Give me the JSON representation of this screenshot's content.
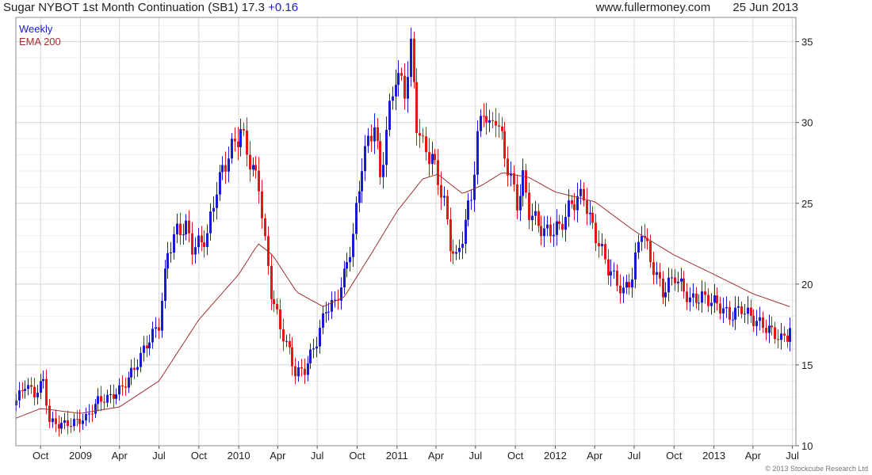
{
  "header": {
    "title": "Sugar NYBOT 1st Month Continuation (SB1)",
    "last": "17.3",
    "change": "+0.16",
    "site": "www.fullermoney.com",
    "date": "25 Jun 2013"
  },
  "legend": {
    "period": "Weekly",
    "indicator": "EMA 200"
  },
  "copyright": "© 2013 Stockcube Research Ltd",
  "colors": {
    "up": "#1a1ad2",
    "down": "#e01818",
    "ema": "#a03030",
    "grid": "#d8d8d8",
    "gridMinor": "#eeeeee"
  },
  "chart_data": {
    "type": "candlestick",
    "interval": "weekly",
    "ylim": [
      10,
      36.5
    ],
    "xlim": [
      "2008-08-05",
      "2013-07-09"
    ],
    "y_ticks": [
      10,
      15,
      20,
      25,
      30,
      35
    ],
    "x_ticks": [
      {
        "date": "2008-10-01",
        "label": "Oct"
      },
      {
        "date": "2009-01-01",
        "label": "2009"
      },
      {
        "date": "2009-04-01",
        "label": "Apr"
      },
      {
        "date": "2009-07-01",
        "label": "Jul"
      },
      {
        "date": "2009-10-01",
        "label": "Oct"
      },
      {
        "date": "2010-01-01",
        "label": "2010"
      },
      {
        "date": "2010-04-01",
        "label": "Apr"
      },
      {
        "date": "2010-07-01",
        "label": "Jul"
      },
      {
        "date": "2010-10-01",
        "label": "Oct"
      },
      {
        "date": "2011-01-01",
        "label": "2011"
      },
      {
        "date": "2011-04-01",
        "label": "Apr"
      },
      {
        "date": "2011-07-01",
        "label": "Jul"
      },
      {
        "date": "2011-10-01",
        "label": "Oct"
      },
      {
        "date": "2012-01-01",
        "label": "2012"
      },
      {
        "date": "2012-04-01",
        "label": "Apr"
      },
      {
        "date": "2012-07-01",
        "label": "Jul"
      },
      {
        "date": "2012-10-01",
        "label": "Oct"
      },
      {
        "date": "2013-01-01",
        "label": "2013"
      },
      {
        "date": "2013-04-01",
        "label": "Apr"
      },
      {
        "date": "2013-07-01",
        "label": "Jul"
      }
    ],
    "grid": true,
    "legend_position": "top-left",
    "close_anchors": [
      [
        "2008-08-05",
        12.8
      ],
      [
        "2008-08-26",
        13.8
      ],
      [
        "2008-09-16",
        13.2
      ],
      [
        "2008-10-07",
        14.0
      ],
      [
        "2008-10-21",
        11.5
      ],
      [
        "2008-11-11",
        11.3
      ],
      [
        "2008-12-09",
        11.4
      ],
      [
        "2009-01-13",
        11.7
      ],
      [
        "2009-02-10",
        12.8
      ],
      [
        "2009-03-10",
        13.0
      ],
      [
        "2009-04-07",
        13.6
      ],
      [
        "2009-05-05",
        14.8
      ],
      [
        "2009-06-02",
        16.3
      ],
      [
        "2009-06-30",
        17.5
      ],
      [
        "2009-07-21",
        22.0
      ],
      [
        "2009-08-11",
        23.3
      ],
      [
        "2009-09-01",
        23.5
      ],
      [
        "2009-09-15",
        22.3
      ],
      [
        "2009-10-06",
        22.6
      ],
      [
        "2009-10-20",
        23.0
      ],
      [
        "2009-11-10",
        26.0
      ],
      [
        "2009-12-08",
        28.0
      ],
      [
        "2010-01-05",
        29.5
      ],
      [
        "2010-02-02",
        27.0
      ],
      [
        "2010-02-16",
        26.2
      ],
      [
        "2010-03-02",
        22.5
      ],
      [
        "2010-03-16",
        19.5
      ],
      [
        "2010-04-06",
        17.3
      ],
      [
        "2010-04-27",
        15.8
      ],
      [
        "2010-05-11",
        14.5
      ],
      [
        "2010-06-01",
        14.7
      ],
      [
        "2010-06-29",
        16.5
      ],
      [
        "2010-07-20",
        18.5
      ],
      [
        "2010-08-10",
        18.8
      ],
      [
        "2010-08-31",
        20.5
      ],
      [
        "2010-09-21",
        23.0
      ],
      [
        "2010-10-12",
        27.5
      ],
      [
        "2010-11-09",
        30.0
      ],
      [
        "2010-11-23",
        26.5
      ],
      [
        "2010-12-07",
        29.5
      ],
      [
        "2010-12-28",
        33.0
      ],
      [
        "2011-01-18",
        32.0
      ],
      [
        "2011-02-01",
        34.5
      ],
      [
        "2011-02-15",
        30.0
      ],
      [
        "2011-03-01",
        28.5
      ],
      [
        "2011-03-22",
        27.8
      ],
      [
        "2011-04-05",
        26.5
      ],
      [
        "2011-04-19",
        25.0
      ],
      [
        "2011-05-03",
        22.5
      ],
      [
        "2011-05-17",
        21.5
      ],
      [
        "2011-05-31",
        23.0
      ],
      [
        "2011-06-21",
        25.5
      ],
      [
        "2011-07-05",
        29.0
      ],
      [
        "2011-07-19",
        31.0
      ],
      [
        "2011-08-02",
        29.5
      ],
      [
        "2011-08-16",
        30.5
      ],
      [
        "2011-09-06",
        28.0
      ],
      [
        "2011-09-20",
        26.5
      ],
      [
        "2011-10-04",
        25.0
      ],
      [
        "2011-10-18",
        26.5
      ],
      [
        "2011-11-01",
        24.5
      ],
      [
        "2011-12-06",
        23.2
      ],
      [
        "2012-01-10",
        23.5
      ],
      [
        "2012-02-07",
        25.0
      ],
      [
        "2012-03-06",
        25.5
      ],
      [
        "2012-03-20",
        24.0
      ],
      [
        "2012-04-10",
        22.5
      ],
      [
        "2012-05-01",
        21.0
      ],
      [
        "2012-06-05",
        19.5
      ],
      [
        "2012-06-26",
        20.5
      ],
      [
        "2012-07-17",
        23.5
      ],
      [
        "2012-08-07",
        21.5
      ],
      [
        "2012-09-04",
        19.5
      ],
      [
        "2012-10-02",
        20.5
      ],
      [
        "2012-11-06",
        19.0
      ],
      [
        "2012-12-04",
        19.2
      ],
      [
        "2013-01-08",
        18.8
      ],
      [
        "2013-02-05",
        18.0
      ],
      [
        "2013-03-05",
        18.5
      ],
      [
        "2013-04-02",
        17.8
      ],
      [
        "2013-05-07",
        17.2
      ],
      [
        "2013-06-04",
        16.6
      ],
      [
        "2013-06-18",
        16.8
      ],
      [
        "2013-06-25",
        17.3
      ]
    ],
    "ema200": [
      [
        "2008-08-05",
        11.7
      ],
      [
        "2008-10-01",
        12.3
      ],
      [
        "2009-01-01",
        12.0
      ],
      [
        "2009-04-01",
        12.4
      ],
      [
        "2009-07-01",
        14.0
      ],
      [
        "2009-10-01",
        17.8
      ],
      [
        "2010-01-01",
        20.6
      ],
      [
        "2010-02-15",
        22.5
      ],
      [
        "2010-03-20",
        21.8
      ],
      [
        "2010-05-15",
        19.5
      ],
      [
        "2010-07-15",
        18.6
      ],
      [
        "2010-09-01",
        19.2
      ],
      [
        "2010-11-01",
        21.8
      ],
      [
        "2011-01-01",
        24.5
      ],
      [
        "2011-03-01",
        26.5
      ],
      [
        "2011-04-05",
        26.8
      ],
      [
        "2011-06-01",
        25.6
      ],
      [
        "2011-07-15",
        26.1
      ],
      [
        "2011-09-01",
        26.9
      ],
      [
        "2011-11-01",
        26.6
      ],
      [
        "2012-01-01",
        25.7
      ],
      [
        "2012-04-01",
        25.1
      ],
      [
        "2012-07-01",
        23.3
      ],
      [
        "2012-10-01",
        21.8
      ],
      [
        "2013-01-01",
        20.6
      ],
      [
        "2013-04-01",
        19.4
      ],
      [
        "2013-06-25",
        18.6
      ]
    ]
  }
}
